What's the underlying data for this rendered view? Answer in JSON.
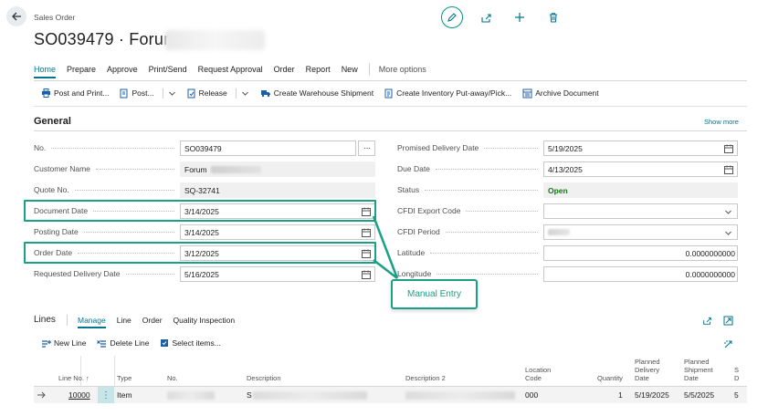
{
  "header": {
    "breadcrumb": "Sales Order",
    "title_prefix": "SO039479 · Forum"
  },
  "menu": {
    "items": [
      "Home",
      "Prepare",
      "Approve",
      "Print/Send",
      "Request Approval",
      "Order",
      "Report",
      "New"
    ],
    "more": "More options"
  },
  "toolbar": {
    "post_and_print": "Post and Print...",
    "post": "Post...",
    "release": "Release",
    "create_warehouse_shipment": "Create Warehouse Shipment",
    "create_inventory_putaway": "Create Inventory Put-away/Pick...",
    "archive_document": "Archive Document"
  },
  "general": {
    "title": "General",
    "show_more": "Show more",
    "left_fields": [
      {
        "label": "No.",
        "value": "SO039479"
      },
      {
        "label": "Customer Name",
        "value": "Forum"
      },
      {
        "label": "Quote No.",
        "value": "SQ-32741"
      },
      {
        "label": "Document Date",
        "value": "3/14/2025"
      },
      {
        "label": "Posting Date",
        "value": "3/14/2025"
      },
      {
        "label": "Order Date",
        "value": "3/12/2025"
      },
      {
        "label": "Requested Delivery Date",
        "value": "5/16/2025"
      }
    ],
    "right_fields": [
      {
        "label": "Promised Delivery Date",
        "value": "5/19/2025"
      },
      {
        "label": "Due Date",
        "value": "4/13/2025"
      },
      {
        "label": "Status",
        "value": "Open"
      },
      {
        "label": "CFDI Export Code",
        "value": ""
      },
      {
        "label": "CFDI Period",
        "value": ""
      },
      {
        "label": "Latitude",
        "value": "0.0000000000"
      },
      {
        "label": "Longitude",
        "value": "0.0000000000"
      }
    ]
  },
  "callout": "Manual Entry",
  "lines": {
    "title": "Lines",
    "tabs": [
      "Manage",
      "Line",
      "Order",
      "Quality Inspection"
    ],
    "actions": {
      "new_line": "New Line",
      "delete_line": "Delete Line",
      "select_items": "Select items..."
    },
    "columns": {
      "line_no": "Line No. ↑",
      "type": "Type",
      "no": "No.",
      "description": "Description",
      "description2": "Description 2",
      "location_code": "Location Code",
      "quantity": "Quantity",
      "planned_delivery_date": "Planned Delivery Date",
      "planned_shipment_date": "Planned Shipment Date",
      "next": "S D"
    },
    "rows": [
      {
        "line_no": "10000",
        "type": "Item",
        "description_prefix": "S",
        "location": "000",
        "quantity": "1",
        "planned_delivery": "5/19/2025",
        "planned_shipment": "5/5/2025",
        "next": "5"
      }
    ]
  },
  "colors": {
    "accent": "#00758f",
    "highlight": "#1aa084",
    "status_open": "#0f7b0f"
  }
}
